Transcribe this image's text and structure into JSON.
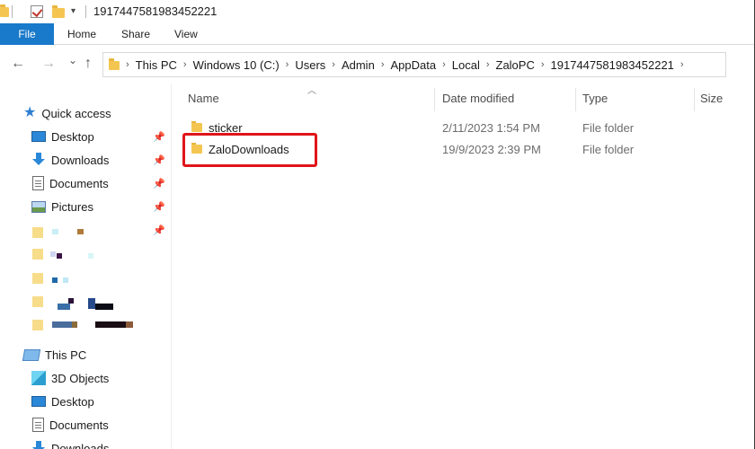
{
  "window": {
    "title": "1917447581983452221"
  },
  "ribbon": {
    "tabs": [
      "File",
      "Home",
      "Share",
      "View"
    ]
  },
  "nav": {
    "back": "←",
    "forward": "→",
    "recent": "⌄",
    "up": "↑"
  },
  "address": {
    "breadcrumbs": [
      "This PC",
      "Windows 10 (C:)",
      "Users",
      "Admin",
      "AppData",
      "Local",
      "ZaloPC",
      "1917447581983452221"
    ]
  },
  "sidebar": {
    "quick_access_label": "Quick access",
    "quick_items": [
      {
        "label": "Desktop",
        "icon": "desktop-icon"
      },
      {
        "label": "Downloads",
        "icon": "downloads-icon"
      },
      {
        "label": "Documents",
        "icon": "documents-icon"
      },
      {
        "label": "Pictures",
        "icon": "pictures-icon"
      }
    ],
    "this_pc_label": "This PC",
    "pc_items": [
      {
        "label": "3D Objects",
        "icon": "3d-objects-icon"
      },
      {
        "label": "Desktop",
        "icon": "desktop-icon"
      },
      {
        "label": "Documents",
        "icon": "documents-icon"
      },
      {
        "label": "Downloads",
        "icon": "downloads-icon"
      }
    ]
  },
  "columns": {
    "name": "Name",
    "date": "Date modified",
    "type": "Type",
    "size": "Size"
  },
  "files": [
    {
      "name": "sticker",
      "date": "2/11/2023 1:54 PM",
      "type": "File folder"
    },
    {
      "name": "ZaloDownloads",
      "date": "19/9/2023 2:39 PM",
      "type": "File folder"
    }
  ],
  "colors": {
    "file_tab": "#1979ca",
    "highlight": "#e0151a",
    "folder": "#f4c651"
  }
}
